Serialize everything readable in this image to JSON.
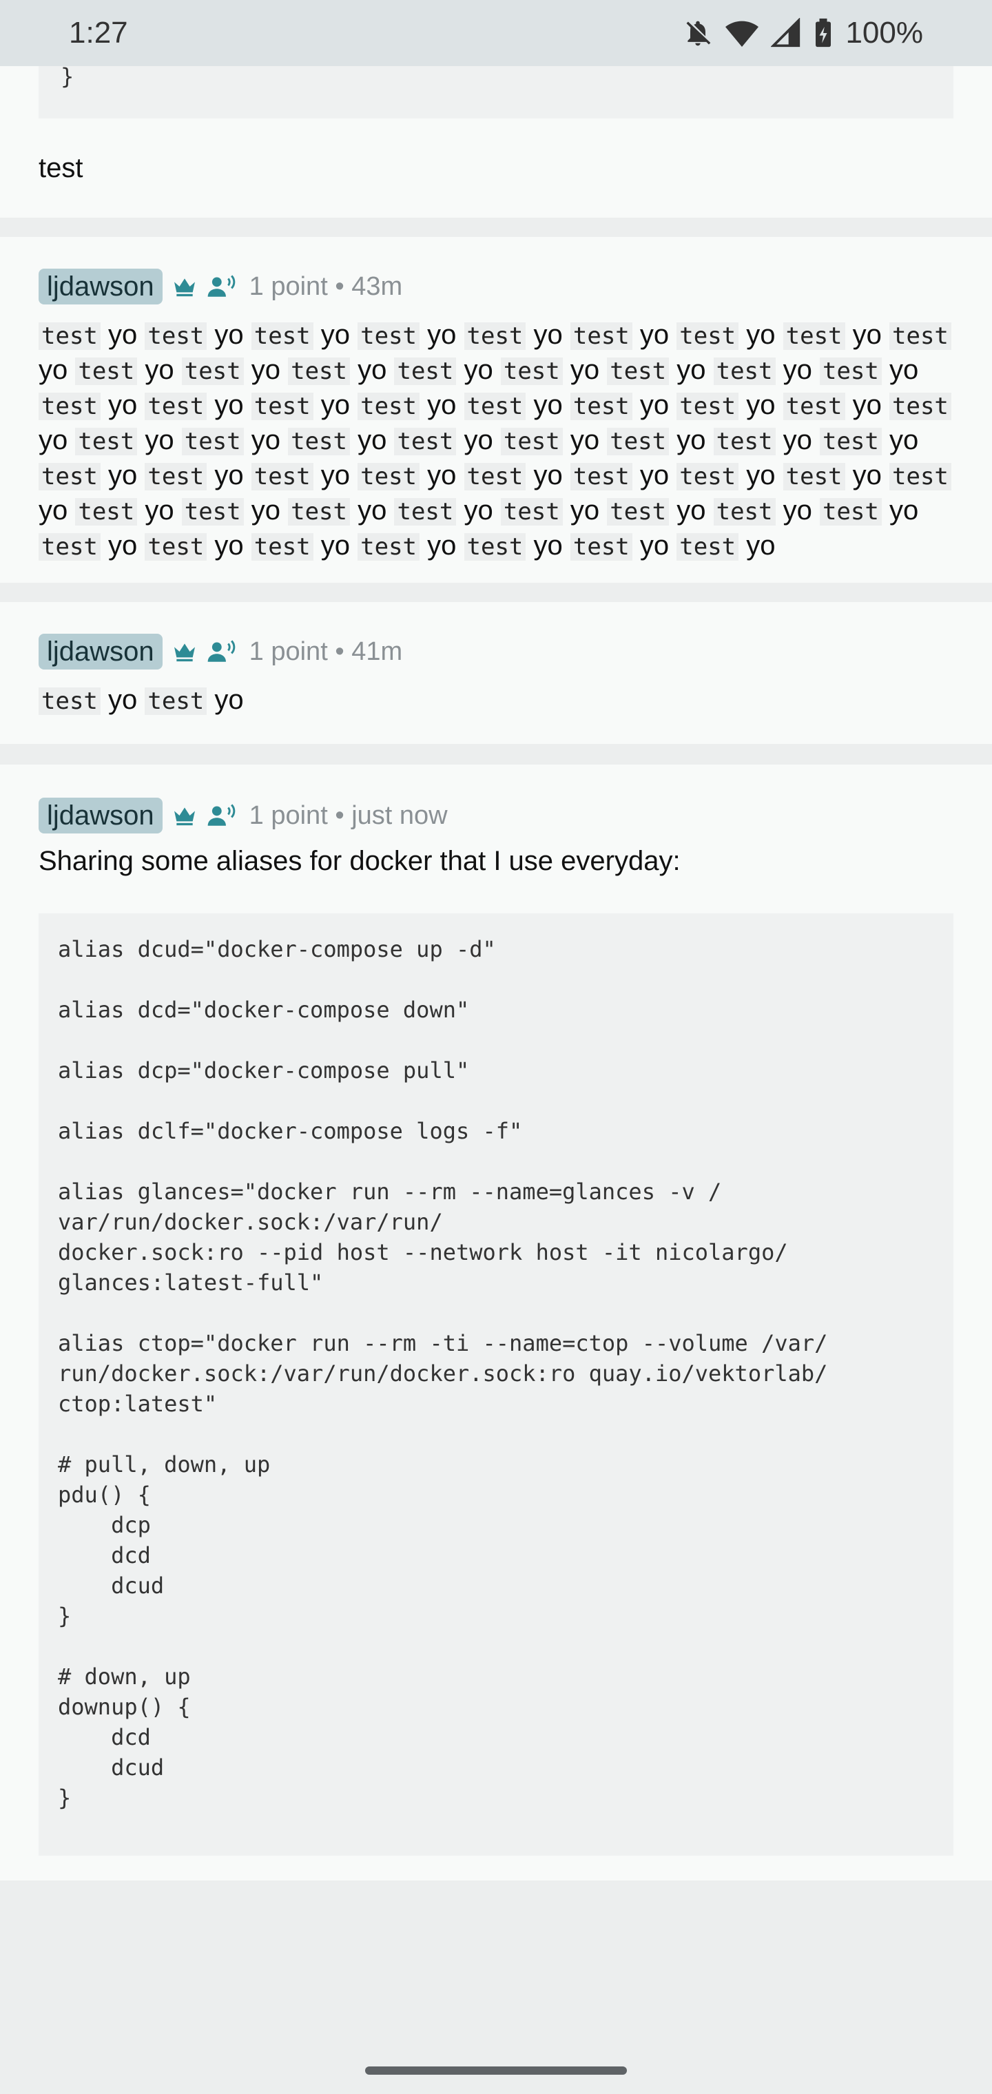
{
  "status_bar": {
    "time": "1:27",
    "battery": "100%",
    "icons": [
      "bell-off-icon",
      "wifi-icon",
      "signal-icon",
      "battery-charging-icon"
    ]
  },
  "top_card": {
    "code_tail": "}",
    "text": "test"
  },
  "comments": [
    {
      "author": "ljdawson",
      "points": "1 point",
      "separator": "•",
      "time": "43m",
      "icons": [
        "crown-icon",
        "moderator-icon"
      ],
      "pairs_count_label": "test yo",
      "code_word": "test",
      "plain_word": "yo"
    },
    {
      "author": "ljdawson",
      "points": "1 point",
      "separator": "•",
      "time": "41m",
      "icons": [
        "crown-icon",
        "moderator-icon"
      ],
      "code_word": "test",
      "plain_word": "yo"
    },
    {
      "author": "ljdawson",
      "points": "1 point",
      "separator": "•",
      "time": "just now",
      "icons": [
        "crown-icon",
        "moderator-icon"
      ],
      "body": "Sharing some aliases for docker that I use everyday:",
      "code": "alias dcud=\"docker-compose up -d\"\n\nalias dcd=\"docker-compose down\"\n\nalias dcp=\"docker-compose pull\"\n\nalias dclf=\"docker-compose logs -f\"\n\nalias glances=\"docker run --rm --name=glances -v /\nvar/run/docker.sock:/var/run/\ndocker.sock:ro --pid host --network host -it nicolargo/\nglances:latest-full\"\n\nalias ctop=\"docker run --rm -ti --name=ctop --volume /var/\nrun/docker.sock:/var/run/docker.sock:ro quay.io/vektorlab/\nctop:latest\"\n\n# pull, down, up\npdu() {\n    dcp\n    dcd\n    dcud\n}\n\n# down, up\ndownup() {\n    dcd\n    dcud\n}"
    }
  ],
  "colors": {
    "accent": "#2e8b95",
    "badge_bg": "#b5cdd3",
    "meta": "#8a9094",
    "page_bg": "#eceeee",
    "card_bg": "#f8faf9"
  }
}
